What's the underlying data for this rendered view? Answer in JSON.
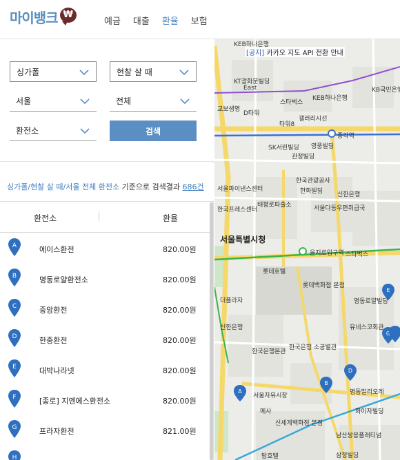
{
  "header": {
    "logo_text": "마이뱅크",
    "logo_symbol": "₩",
    "nav": [
      {
        "label": "예금",
        "active": false
      },
      {
        "label": "대출",
        "active": false
      },
      {
        "label": "환율",
        "active": true
      },
      {
        "label": "보험",
        "active": false
      }
    ]
  },
  "filters": {
    "currency": "싱가폴",
    "trade_type": "현찰 살 때",
    "region": "서울",
    "district": "전체",
    "place_type": "환전소",
    "search_label": "검색"
  },
  "result": {
    "condition": "싱가폴/현찰 살 때/서울 전체 환전소",
    "middle": " 기준으로 검색결과 ",
    "count": "686건"
  },
  "table": {
    "col_name": "환전소",
    "col_rate": "환율",
    "rows": [
      {
        "marker": "A",
        "name": "에이스환전",
        "rate": "820.00원"
      },
      {
        "marker": "B",
        "name": "명동로얄환전소",
        "rate": "820.00원"
      },
      {
        "marker": "C",
        "name": "중앙환전",
        "rate": "820.00원"
      },
      {
        "marker": "D",
        "name": "한중환전",
        "rate": "820.00원"
      },
      {
        "marker": "E",
        "name": "대박나라넷",
        "rate": "820.00원"
      },
      {
        "marker": "F",
        "name": "[종로] 지엔에스환전소",
        "rate": "820.00원"
      },
      {
        "marker": "G",
        "name": "프라자환전",
        "rate": "821.00원"
      },
      {
        "marker": "H",
        "name": "",
        "rate": ""
      }
    ]
  },
  "map": {
    "notice_tag": "[공지]",
    "notice_text": " 카카오 지도 API 전환 안내",
    "labels": [
      {
        "text": "KEB하나은행",
        "big": false
      },
      {
        "text": "KT광화문빌딩",
        "big": false
      },
      {
        "text": "East",
        "big": false
      },
      {
        "text": "스타벅스",
        "big": false
      },
      {
        "text": "KEB하나은행",
        "big": false
      },
      {
        "text": "KB국민은행",
        "big": false
      },
      {
        "text": "교보생명",
        "big": false
      },
      {
        "text": "D타워",
        "big": false
      },
      {
        "text": "갤러리시선",
        "big": false
      },
      {
        "text": "타워8",
        "big": false
      },
      {
        "text": "종각역",
        "big": false
      },
      {
        "text": "SK서린빌딩",
        "big": false
      },
      {
        "text": "영풍빌딩",
        "big": false
      },
      {
        "text": "관정빌딩",
        "big": false
      },
      {
        "text": "서울파이낸스센터",
        "big": false
      },
      {
        "text": "한국관광공사",
        "big": false
      },
      {
        "text": "한화빌딩",
        "big": false
      },
      {
        "text": "신한은행",
        "big": false
      },
      {
        "text": "태평로파출소",
        "big": false
      },
      {
        "text": "서울다동우편취급국",
        "big": false
      },
      {
        "text": "한국프레스센터",
        "big": false
      },
      {
        "text": "서울특별시청",
        "big": true
      },
      {
        "text": "을지로입구역",
        "big": false
      },
      {
        "text": "스타벅스",
        "big": false
      },
      {
        "text": "더플라자",
        "big": false
      },
      {
        "text": "롯데백화점 본점",
        "big": false
      },
      {
        "text": "롯데호텔",
        "big": false
      },
      {
        "text": "명동로얄빌딩",
        "big": false
      },
      {
        "text": "유네스코회관",
        "big": false
      },
      {
        "text": "신한은행",
        "big": false
      },
      {
        "text": "한국은행본관",
        "big": false
      },
      {
        "text": "한국은행 소공별관",
        "big": false
      },
      {
        "text": "서울자유시장",
        "big": false
      },
      {
        "text": "신세계백화점 본점",
        "big": false
      },
      {
        "text": "명동밀리오레",
        "big": false
      },
      {
        "text": "화이자빌딩",
        "big": false
      },
      {
        "text": "메사",
        "big": false
      },
      {
        "text": "남산쌍용플래티넘",
        "big": false
      },
      {
        "text": "삼정빌딩",
        "big": false
      },
      {
        "text": "탑호텔",
        "big": false
      }
    ]
  },
  "colors": {
    "accent": "#5b8fc4",
    "link_blue": "#3e7fc1",
    "marker_blue": "#2f6fc0",
    "logo_brown": "#6b2b2b"
  }
}
